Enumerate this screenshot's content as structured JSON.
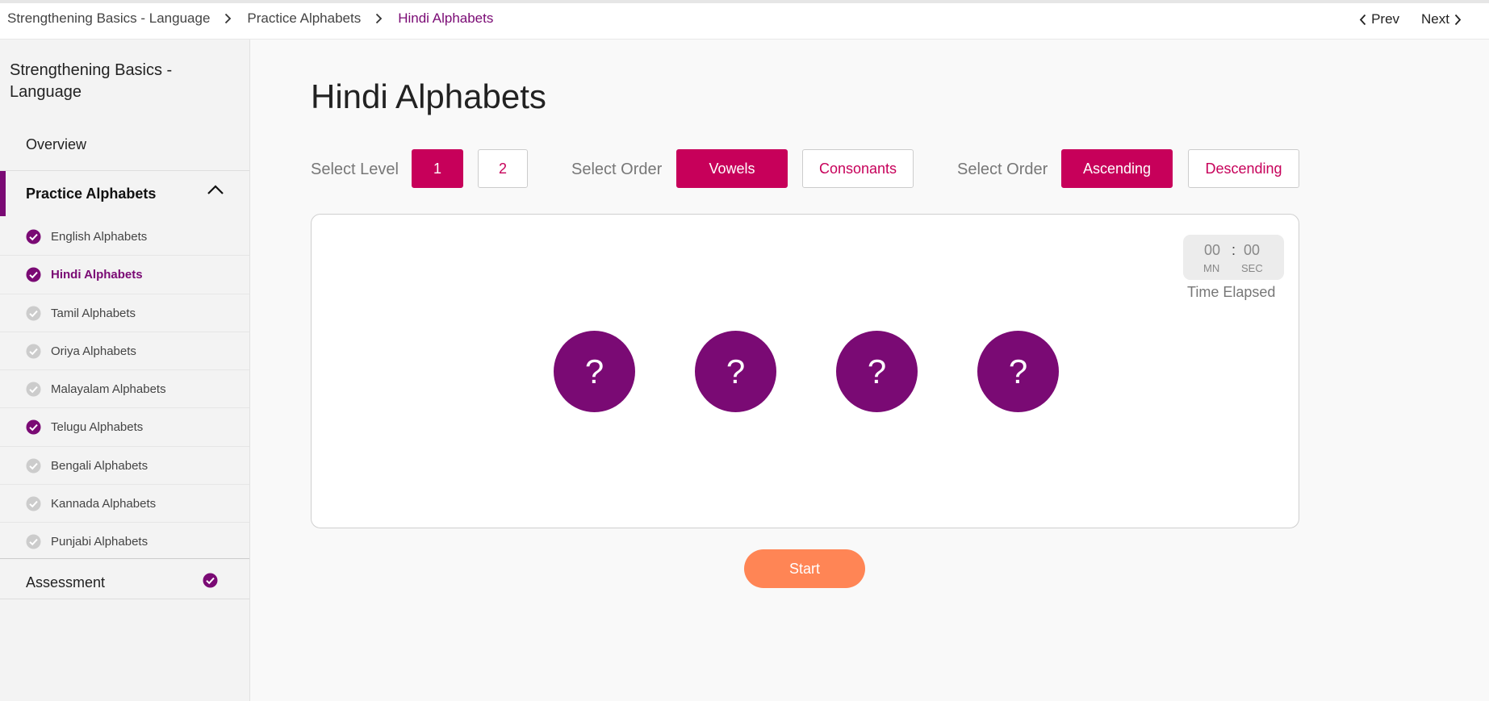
{
  "breadcrumb": [
    {
      "label": "Strengthening Basics - Language"
    },
    {
      "label": "Practice Alphabets"
    },
    {
      "label": "Hindi Alphabets"
    }
  ],
  "topnav": {
    "prev_label": "Prev",
    "next_label": "Next"
  },
  "sidebar": {
    "course_title": "Strengthening Basics - Language",
    "overview_label": "Overview",
    "section_label": "Practice Alphabets",
    "items": [
      {
        "label": "English Alphabets",
        "completed": true
      },
      {
        "label": "Hindi Alphabets",
        "completed": true,
        "active": true
      },
      {
        "label": "Tamil Alphabets",
        "completed": false
      },
      {
        "label": "Oriya Alphabets",
        "completed": false
      },
      {
        "label": "Malayalam Alphabets",
        "completed": false
      },
      {
        "label": "Telugu Alphabets",
        "completed": true
      },
      {
        "label": "Bengali Alphabets",
        "completed": false
      },
      {
        "label": "Kannada Alphabets",
        "completed": false
      },
      {
        "label": "Punjabi Alphabets",
        "completed": false
      }
    ],
    "assessment_label": "Assessment",
    "assessment_completed": true
  },
  "main": {
    "title": "Hindi Alphabets",
    "level": {
      "label": "Select Level",
      "options": [
        "1",
        "2"
      ],
      "selected": "1"
    },
    "type_order": {
      "label": "Select Order",
      "options": [
        "Vowels",
        "Consonants"
      ],
      "selected": "Vowels"
    },
    "sort_order": {
      "label": "Select Order",
      "options": [
        "Ascending",
        "Descending"
      ],
      "selected": "Ascending"
    },
    "timer": {
      "minutes": "00",
      "separator": ":",
      "seconds": "00",
      "min_unit": "MN",
      "sec_unit": "SEC",
      "label": "Time Elapsed"
    },
    "cards": [
      "?",
      "?",
      "?",
      "?"
    ],
    "start_label": "Start"
  },
  "colors": {
    "brand_purple": "#7a0a74",
    "accent_pink": "#c7005a",
    "start_orange": "#ff8555",
    "check_gray": "#cccccc"
  }
}
